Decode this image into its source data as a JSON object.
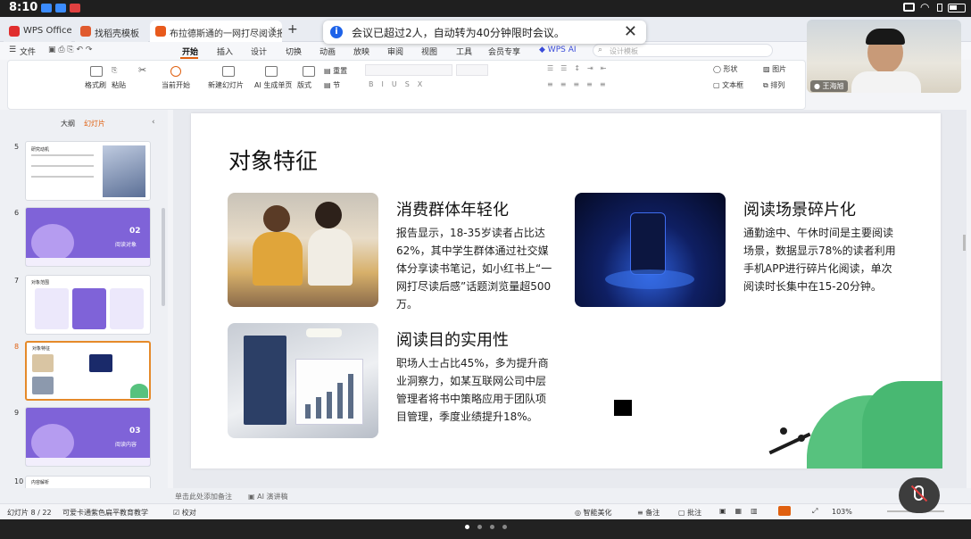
{
  "status_bar": {
    "time": "8:10"
  },
  "tabs": [
    {
      "label": "WPS Office",
      "color": "#e02e2e"
    },
    {
      "label": "找稻壳模板",
      "color": "#e05a2e"
    },
    {
      "label": "布拉德斯通的一网打尽阅读报告",
      "color": "#e85a1c"
    }
  ],
  "tab_add_label": "+",
  "notice": {
    "text": "会议已超过2人，自动转为40分钟限时会议。",
    "info_symbol": "i",
    "close_symbol": "✕"
  },
  "menu": {
    "file": "文件",
    "items": [
      "开始",
      "插入",
      "设计",
      "切换",
      "动画",
      "放映",
      "审阅",
      "视图",
      "工具",
      "会员专享"
    ],
    "wps_ai": "WPS AI",
    "search_placeholder": "设计模板"
  },
  "ribbon": {
    "format_painter": "格式刷",
    "paste": "粘贴",
    "current_start": "当前开始",
    "new_slide": "新建幻灯片",
    "ai_single": "AI 生成单页",
    "layout": "版式",
    "section": "节",
    "reset": "重置",
    "shape": "形状",
    "picture": "图片",
    "textbox": "文本框",
    "arrange": "排列"
  },
  "video": {
    "participant": "王海旭"
  },
  "panel": {
    "tab_outline": "大纲",
    "tab_slides": "幻灯片",
    "add": "+"
  },
  "thumbnails": [
    {
      "num": "5",
      "title": "研究动机"
    },
    {
      "num": "6",
      "title": "02",
      "sub": "阅读对象"
    },
    {
      "num": "7",
      "title": "对象范围"
    },
    {
      "num": "8",
      "title": "对象特征"
    },
    {
      "num": "9",
      "title": "03",
      "sub": "阅读内容"
    },
    {
      "num": "10",
      "title": "内容解析"
    }
  ],
  "slide": {
    "title": "对象特征",
    "s1_title": "消费群体年轻化",
    "s1_body": "报告显示，18-35岁读者占比达62%，其中学生群体通过社交媒体分享读书笔记，如小红书上“一网打尽读后感”话题浏览量超500万。",
    "s2_title": "阅读场景碎片化",
    "s2_body": "通勤途中、午休时间是主要阅读场景，数据显示78%的读者利用手机APP进行碎片化阅读，单次阅读时长集中在15-20分钟。",
    "s3_title": "阅读目的实用性",
    "s3_body": "职场人士占比45%，多为提升商业洞察力，如某互联网公司中层管理者将书中策略应用于团队项目管理，季度业绩提升18%。"
  },
  "notes": {
    "placeholder": "单击此处添加备注",
    "ai_label": "AI 演讲稿"
  },
  "statusbottom": {
    "slide_info": "幻灯片 8 / 22",
    "theme": "可爱卡通紫色扁平教育教学",
    "proof": "校对",
    "beautify": "智能美化",
    "notes": "备注",
    "comment": "批注",
    "zoom": "103%"
  }
}
